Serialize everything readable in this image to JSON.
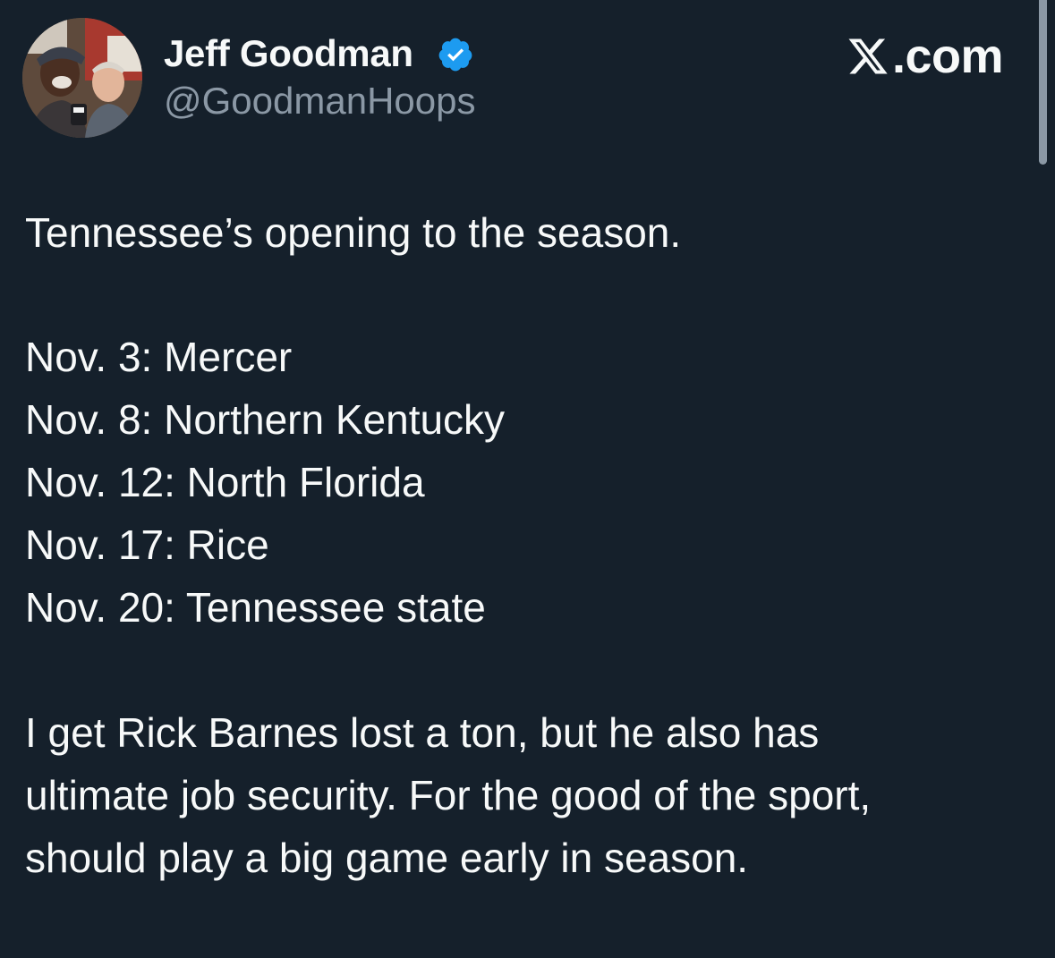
{
  "author": {
    "display_name": "Jeff Goodman",
    "handle": "@GoodmanHoops",
    "verified": true,
    "avatar": "profile-photo"
  },
  "brand": {
    "logo": "x-logo-icon",
    "suffix": ".com"
  },
  "colors": {
    "background": "#15202b",
    "text": "#f7f9f9",
    "muted": "#8b98a5",
    "verified": "#1d9bf0"
  },
  "tweet": {
    "intro": "Tennessee’s opening to the season.",
    "schedule": [
      "Nov. 3: Mercer",
      "Nov. 8: Northern Kentucky",
      "Nov. 12: North Florida",
      "Nov. 17: Rice",
      "Nov. 20: Tennessee state"
    ],
    "closing": [
      "I get Rick Barnes lost a ton, but he also has",
      "ultimate job security. For the good of the sport,",
      "should play a big game early in season."
    ]
  }
}
